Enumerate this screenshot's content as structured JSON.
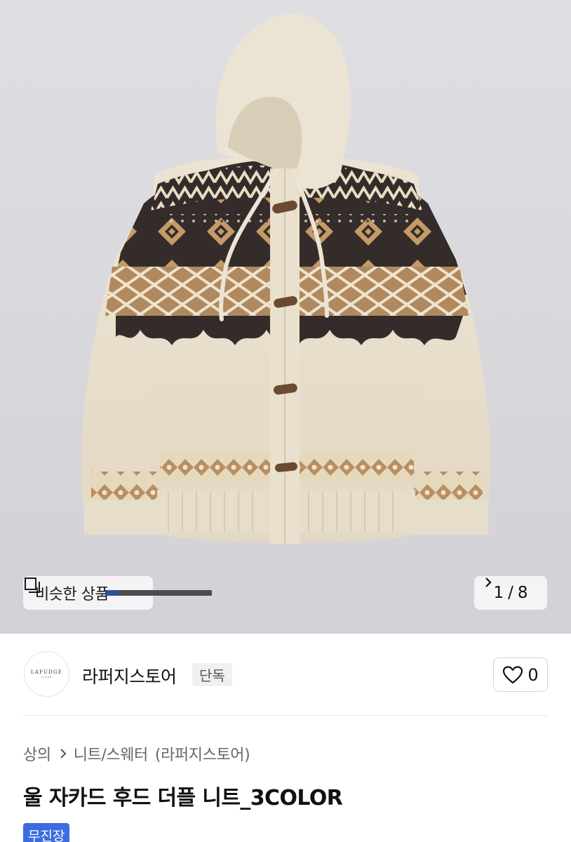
{
  "hero": {
    "similar_label": "비슷한 상품",
    "current_page": "1",
    "separator": "/",
    "total_pages": "8",
    "progress": 0.125
  },
  "seller": {
    "logo_text": "LAFUDGE",
    "logo_subtext": "STORE",
    "name": "라퍼지스토어",
    "badge": "단독",
    "like_count": "0"
  },
  "breadcrumb": {
    "category": "상의",
    "subcategory": "니트/스웨터",
    "store": "(라퍼지스토어)"
  },
  "product": {
    "title": "울 자카드 후드 더플 니트_3COLOR",
    "shipping_badge": "무진장"
  },
  "colors": {
    "accent": "#3b6de0",
    "knit_cream": "#e8dfcc",
    "knit_brown": "#3a3130",
    "knit_tan": "#b0895f"
  }
}
